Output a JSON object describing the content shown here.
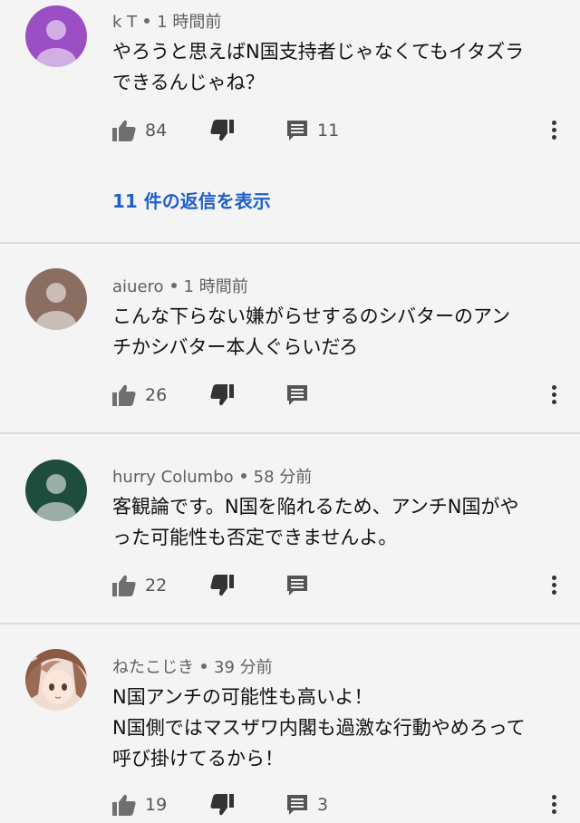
{
  "comments": [
    {
      "author": "k T",
      "time": "1 時間前",
      "lines": [
        "やろうと思えばN国支持者じゃなくてもイタズラ",
        "できるんじゃね？"
      ],
      "likes": "84",
      "reply_count": "11",
      "show_replies": "11 件の返信を表示",
      "avatar_color": "#9a4fc4"
    },
    {
      "author": "aiuero",
      "time": "1 時間前",
      "lines": [
        "こんな下らない嫌がらせするのシバターのアン",
        "チかシバター本人ぐらいだろ"
      ],
      "likes": "26",
      "avatar_color": "#8b6e62"
    },
    {
      "author": "hurry Columbo",
      "time": "58 分前",
      "lines": [
        "客観論です。N国を陥れるため、アンチN国がや",
        "った可能性も否定できませんよ。"
      ],
      "likes": "22",
      "avatar_color": "#1f4d3d"
    },
    {
      "author": "ねたこじき",
      "time": "39 分前",
      "lines": [
        "N国アンチの可能性も高いよ！",
        "N国側ではマスザワ内閣も過激な行動やめろって",
        "呼び掛けてるから！"
      ],
      "likes": "19",
      "reply_count": "3"
    }
  ],
  "icons": {
    "like": "thumb-up-icon",
    "dislike": "thumb-down-icon",
    "reply": "comment-icon",
    "more": "more-vert-icon"
  }
}
